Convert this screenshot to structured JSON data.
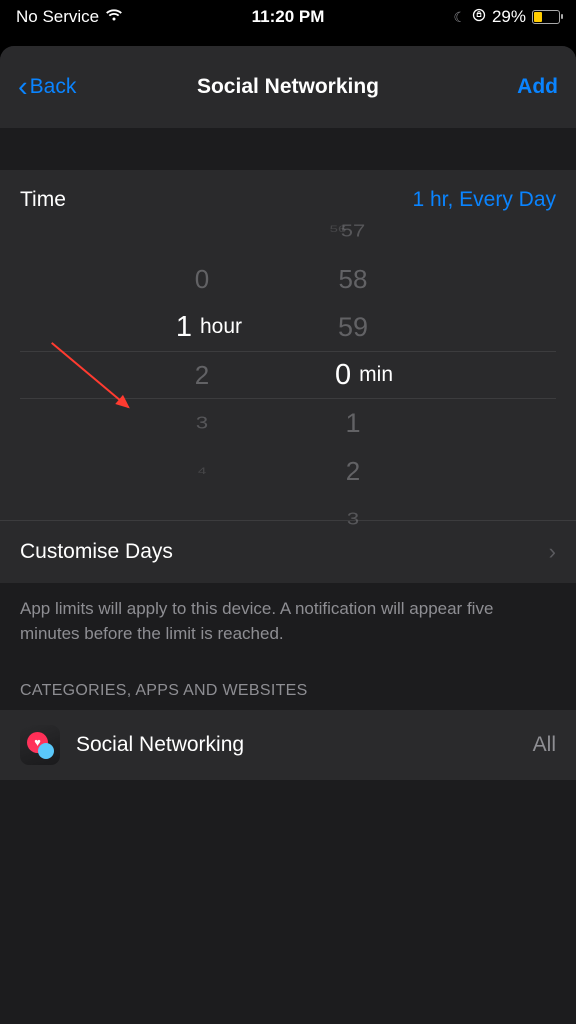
{
  "status_bar": {
    "carrier": "No Service",
    "time": "11:20 PM",
    "battery_pct": "29%"
  },
  "nav": {
    "back_label": "Back",
    "title": "Social Networking",
    "add_label": "Add"
  },
  "time_section": {
    "label": "Time",
    "value": "1 hr, Every Day"
  },
  "picker": {
    "hours": {
      "above4": "",
      "above3": "",
      "above2": "",
      "above1": "0",
      "sel": "1",
      "unit": "hour",
      "below1": "2",
      "below2": "3",
      "below3": "4"
    },
    "mins": {
      "above4": "56",
      "above3": "57",
      "above2": "58",
      "above1": "59",
      "sel": "0",
      "unit": "min",
      "below1": "1",
      "below2": "2",
      "below3": "3"
    }
  },
  "customise": {
    "label": "Customise Days"
  },
  "help_text": "App limits will apply to this device. A notification will appear five minutes before the limit is reached.",
  "section_header": "CATEGORIES, APPS AND WEBSITES",
  "category": {
    "label": "Social Networking",
    "value": "All"
  }
}
